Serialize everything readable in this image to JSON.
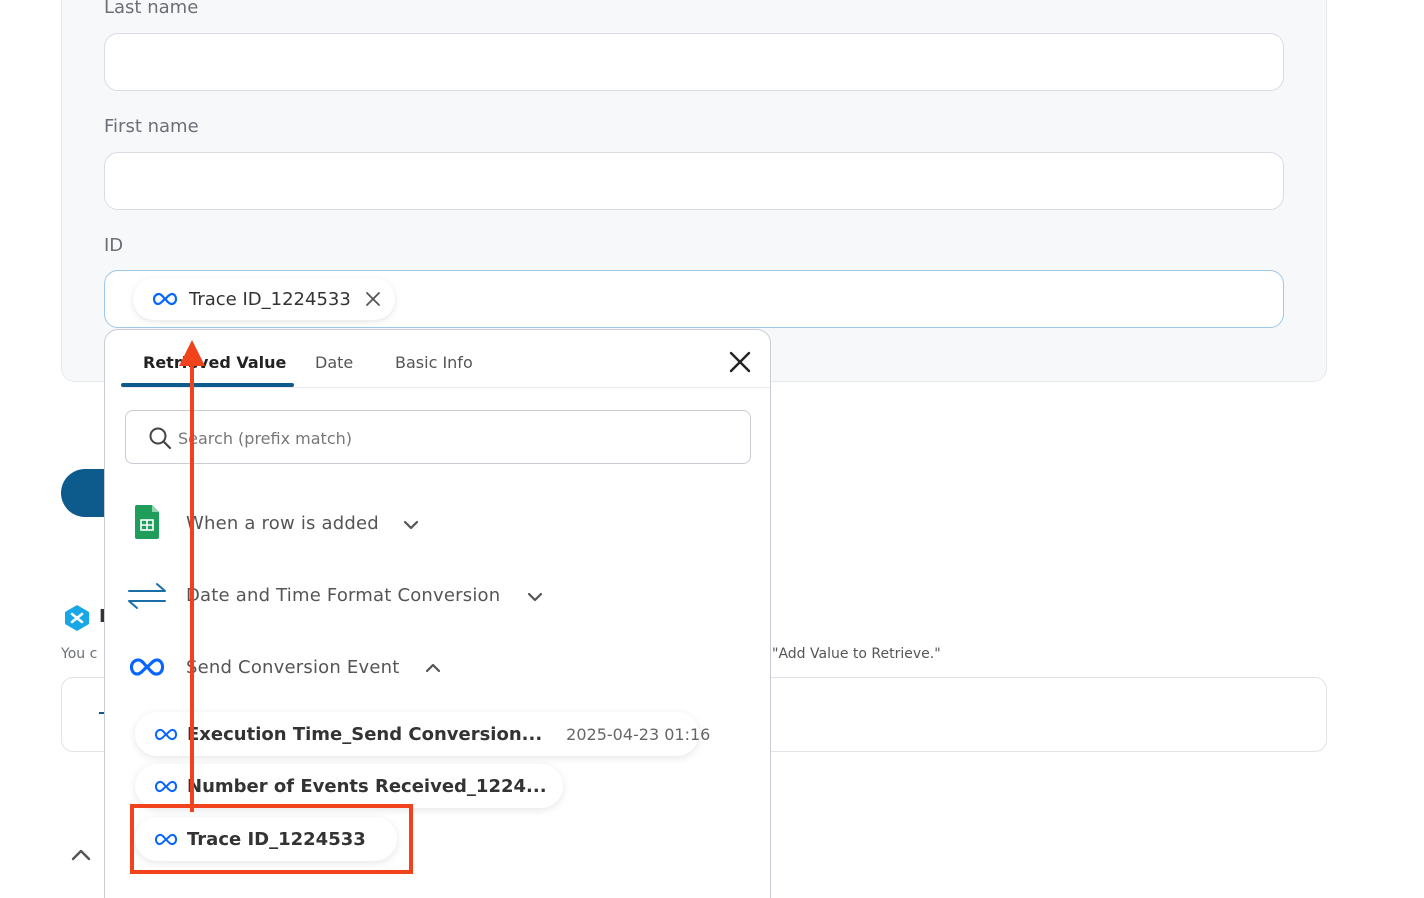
{
  "form": {
    "last_name_label": "Last name",
    "first_name_label": "First name",
    "id_label": "ID",
    "id_chip_label": "Trace ID_1224533"
  },
  "background": {
    "helper_prefix": "You c",
    "helper_suffix": "\"Add Value to Retrieve.\"",
    "partial_title_letter": "F"
  },
  "popup": {
    "tabs": [
      {
        "label": "Retrieved Value",
        "active": true
      },
      {
        "label": "Date",
        "active": false
      },
      {
        "label": "Basic Info",
        "active": false
      }
    ],
    "search": {
      "placeholder": "Search (prefix match)",
      "value": ""
    },
    "sources": [
      {
        "label": "When a row is added",
        "icon": "google-sheets-icon",
        "expanded": false
      },
      {
        "label": "Date and Time Format Conversion",
        "icon": "swap-arrows-icon",
        "expanded": false
      },
      {
        "label": "Send Conversion Event",
        "icon": "meta-icon",
        "expanded": true
      }
    ],
    "values": [
      {
        "label": "Execution Time_Send Conversion...",
        "value": "2025-04-23 01:16"
      },
      {
        "label": "Number of Events Received_1224...",
        "value": ""
      },
      {
        "label": "Trace ID_1224533",
        "value": ""
      }
    ]
  },
  "colors": {
    "accent": "#0d5b8c",
    "meta_blue": "#0866ff",
    "sheets_green": "#1e9e5a",
    "annotation_red": "#f0421c"
  }
}
